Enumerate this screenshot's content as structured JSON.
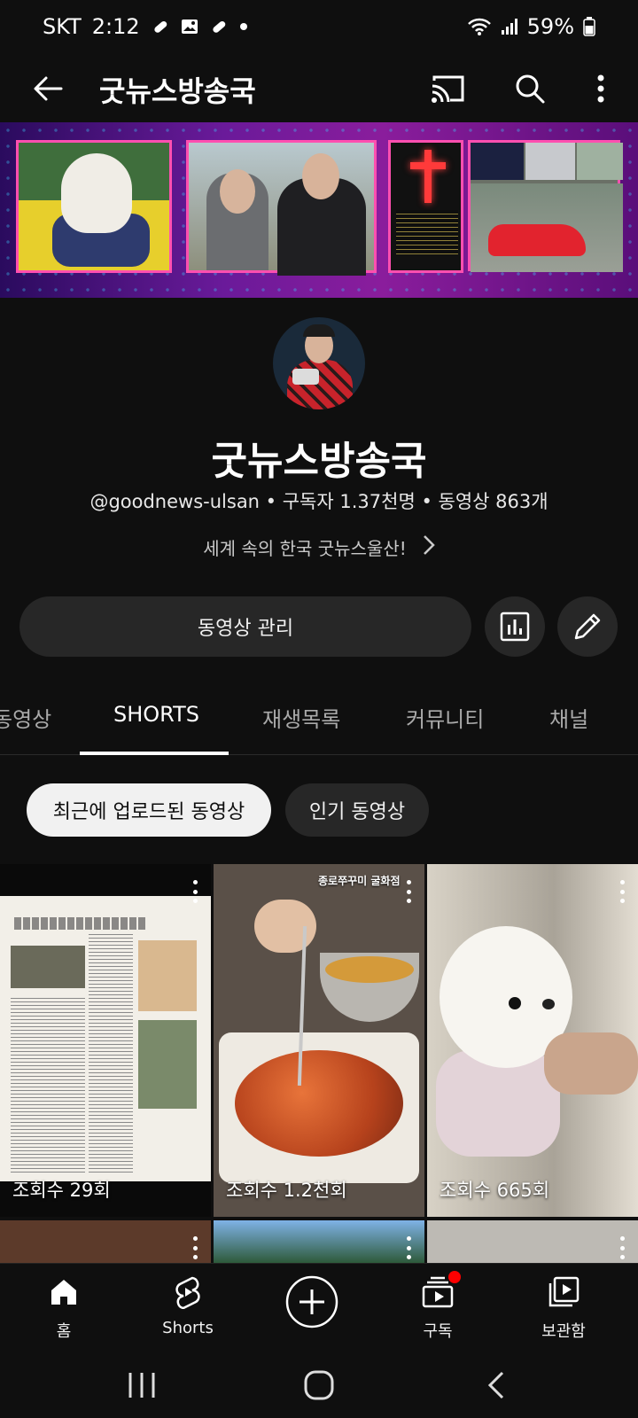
{
  "status_bar": {
    "carrier": "SKT",
    "time": "2:12",
    "battery": "59%"
  },
  "app_bar": {
    "title": "굿뉴스방송국",
    "icons": [
      "back-arrow-icon",
      "cast-icon",
      "search-icon",
      "more-vertical-icon"
    ]
  },
  "channel": {
    "name": "굿뉴스방송국",
    "meta": "@goodnews-ulsan • 구독자 1.37천명 • 동영상 863개",
    "description": "세계 속의 한국 굿뉴스울산!"
  },
  "actions": {
    "manage_label": "동영상 관리",
    "icons": [
      "analytics-icon",
      "edit-pencil-icon"
    ]
  },
  "tabs": [
    {
      "label": "동영상"
    },
    {
      "label": "SHORTS"
    },
    {
      "label": "재생목록"
    },
    {
      "label": "커뮤니티"
    },
    {
      "label": "채널"
    }
  ],
  "active_tab": "SHORTS",
  "chips": [
    {
      "label": "최근에 업로드된 동영상",
      "selected": true
    },
    {
      "label": "인기 동영상",
      "selected": false
    }
  ],
  "shorts": [
    {
      "views": "조회수 29회",
      "overlay": ""
    },
    {
      "views": "조회수 1.2천회",
      "overlay": "종로쭈꾸미 굴화점"
    },
    {
      "views": "조회수 665회",
      "overlay": ""
    }
  ],
  "bottom_nav": [
    {
      "label": "홈",
      "icon": "home-icon"
    },
    {
      "label": "Shorts",
      "icon": "shorts-icon"
    },
    {
      "label": "",
      "icon": "create-plus-icon"
    },
    {
      "label": "구독",
      "icon": "subscriptions-icon"
    },
    {
      "label": "보관함",
      "icon": "library-icon"
    }
  ],
  "colors": {
    "background": "#0f0f0f",
    "surface": "#272727",
    "accent_red": "#ff0000",
    "chip_selected": "#f1f1f1"
  }
}
